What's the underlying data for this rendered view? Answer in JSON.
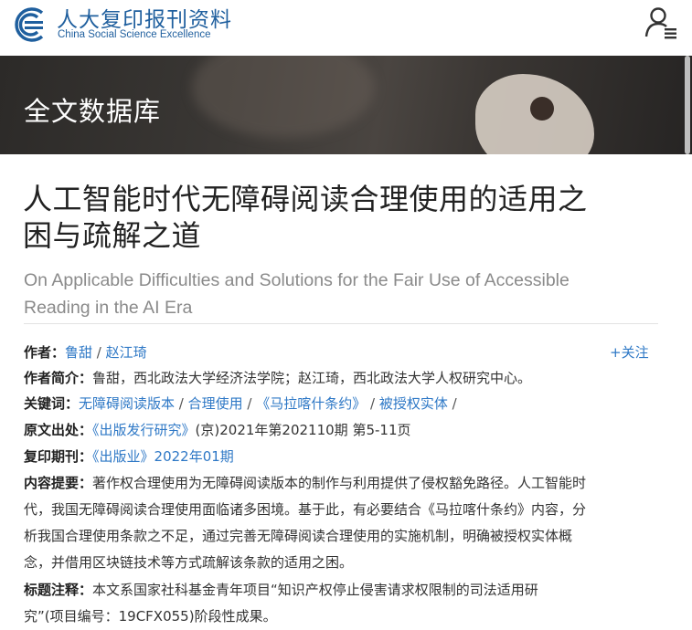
{
  "header": {
    "logo_cn": "人大复印报刊资料",
    "logo_en": "China Social Science Excellence"
  },
  "banner": {
    "title": "全文数据库"
  },
  "article": {
    "title_cn_line1": "人工智能时代无障碍阅读合理使用的适用之",
    "title_cn_line2": "困与疏解之道",
    "title_en_line1": "On Applicable Difficulties and Solutions for the Fair Use of Accessible",
    "title_en_line2": "Reading in the AI Era"
  },
  "meta": {
    "author_label": "作者：",
    "authors": [
      "鲁甜",
      "赵江琦"
    ],
    "author_sep": " / ",
    "follow": "+关注",
    "bio_label": "作者简介：",
    "bio_text": "鲁甜，西北政法大学经济法学院；赵江琦，西北政法大学人权研究中心。",
    "keywords_label": "关键词：",
    "keywords": [
      "无障碍阅读版本",
      "合理使用",
      "《马拉喀什条约》",
      "被授权实体"
    ],
    "source_label": "原文出处：",
    "source_link": "《出版发行研究》",
    "source_text": "(京)2021年第202110期 第5-11页",
    "reprint_label": "复印期刊：",
    "reprint_journal": "《出版业》",
    "reprint_issue": "2022年01期",
    "abstract_label": "内容提要：",
    "abstract_line1": "著作权合理使用为无障碍阅读版本的制作与利用提供了侵权豁免路径。人工智能时",
    "abstract_line2": "代，我国无障碍阅读合理使用面临诸多困境。基于此，有必要结合《马拉喀什条约》内容，分",
    "abstract_line3": "析我国合理使用条款之不足，通过完善无障碍阅读合理使用的实施机制，明确被授权实体概",
    "abstract_line4": "念，并借用区块链技术等方式疏解该条款的适用之困。",
    "note_label": "标题注释：",
    "note_line1": "本文系国家社科基金青年项目“知识产权停止侵害请求权限制的司法适用研",
    "note_line2": "究”(项目编号：19CFX055)阶段性成果。"
  },
  "colors": {
    "brand": "#1f5f9e",
    "link": "#2e78c6"
  },
  "icons": {
    "logo": "csse-logo-icon",
    "user": "user-menu-icon"
  }
}
